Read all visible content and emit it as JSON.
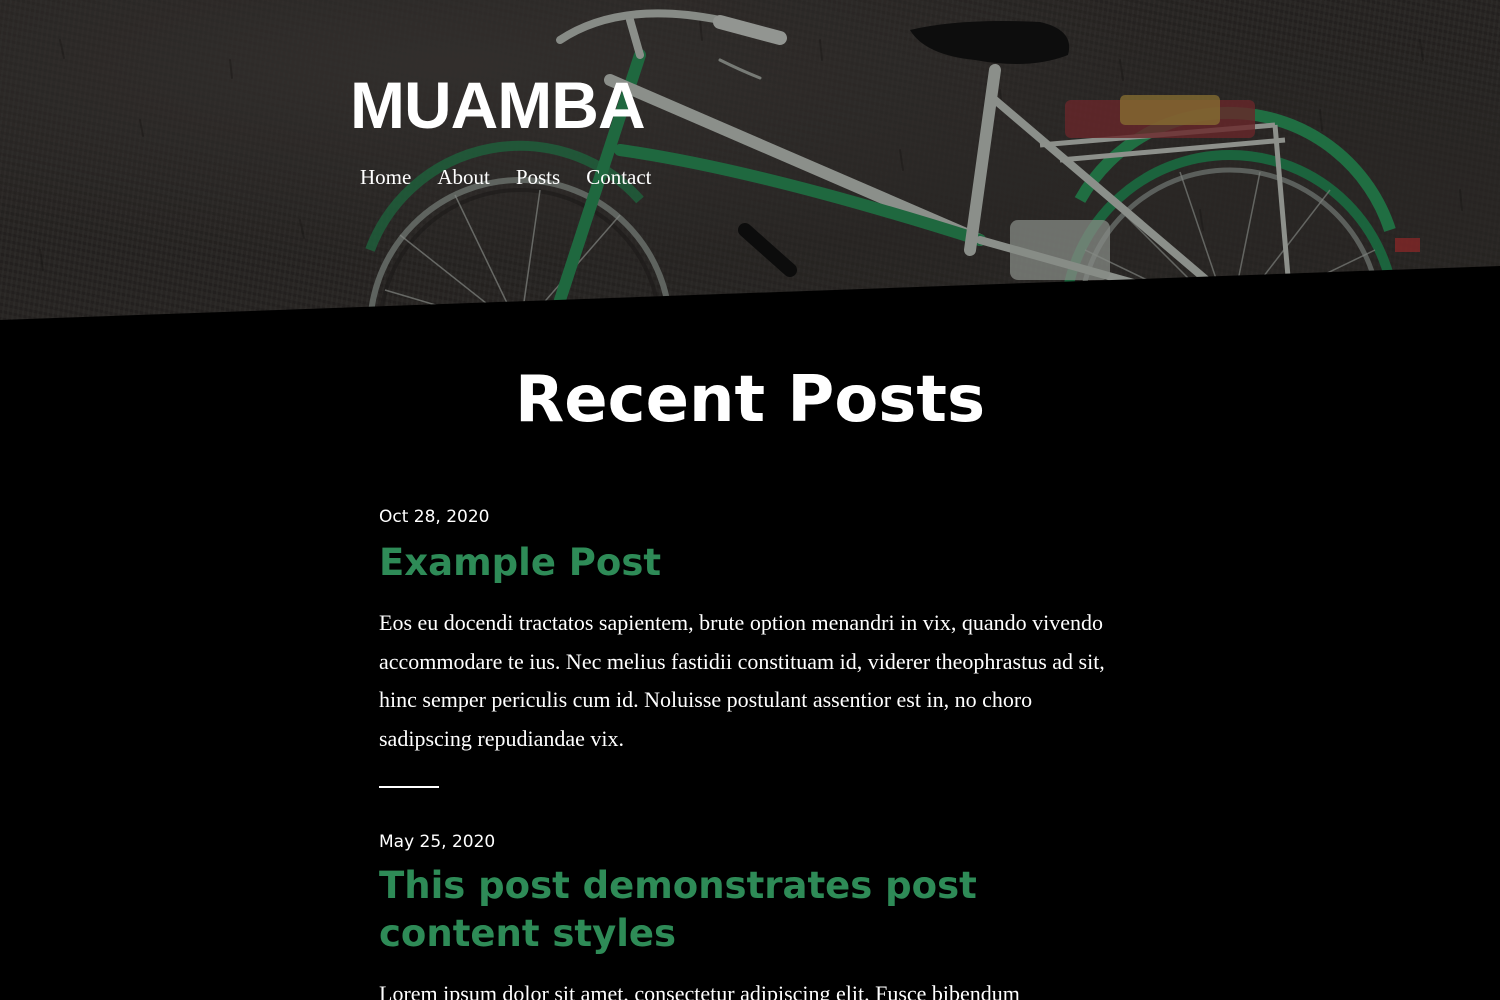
{
  "site": {
    "title": "MUAMBA",
    "nav": [
      "Home",
      "About",
      "Posts",
      "Contact"
    ]
  },
  "hero": {
    "image": "bicycle-against-wall",
    "colors": {
      "wall": "#3a3633",
      "bike_frame": "#2f8f5c",
      "bike_frame_light": "#b8c0b8"
    }
  },
  "main": {
    "heading": "Recent Posts",
    "posts": [
      {
        "date": "Oct 28, 2020",
        "title": "Example Post",
        "excerpt": "Eos eu docendi tractatos sapientem, brute option menandri in vix, quando vivendo accommodare te ius. Nec melius fastidii constituam id, viderer theophrastus ad sit, hinc semper periculis cum id. Noluisse postulant assentior est in, no choro sadipscing repudiandae vix."
      },
      {
        "date": "May 25, 2020",
        "title": "This post demonstrates post content styles",
        "excerpt": "Lorem ipsum dolor sit amet, consectetur adipiscing elit. Fusce bibendum"
      }
    ]
  },
  "theme": {
    "background": "#000000",
    "accent": "#2e8b57",
    "text": "#ffffff"
  }
}
